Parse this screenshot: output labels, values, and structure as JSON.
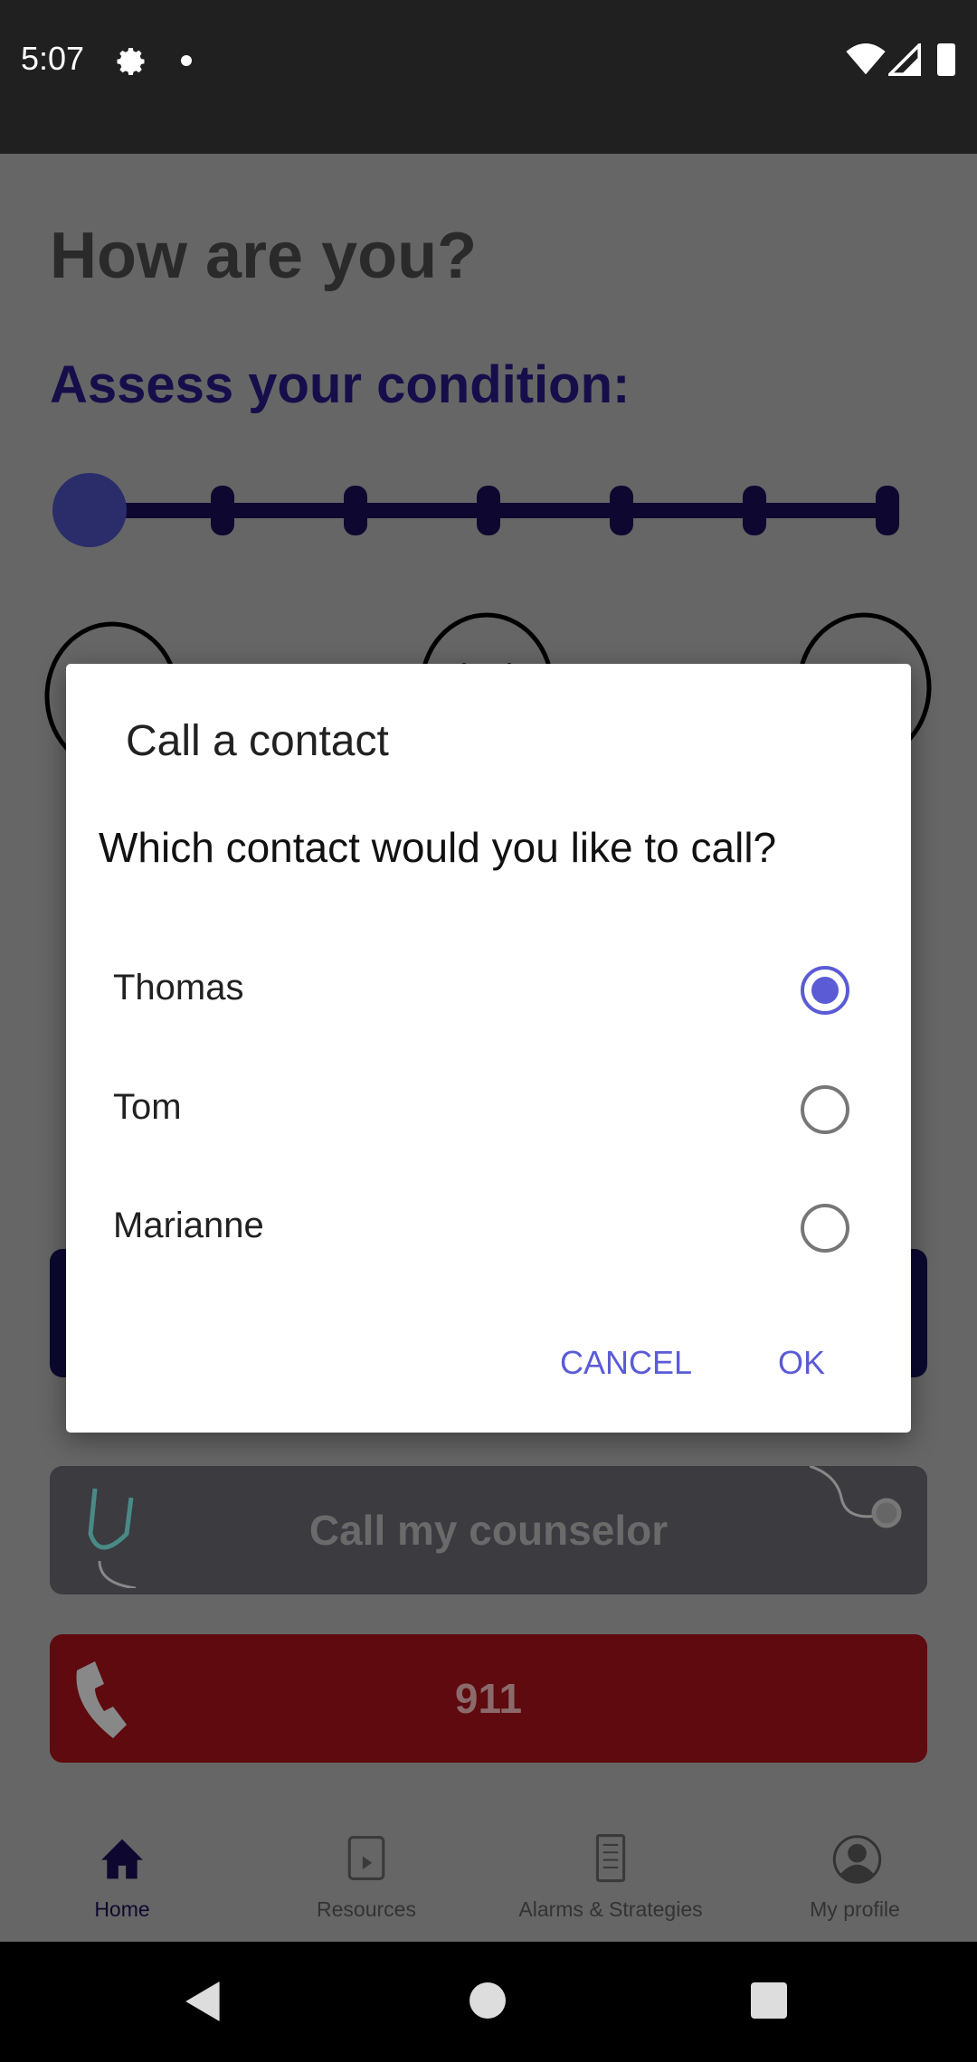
{
  "status_bar": {
    "time": "5:07",
    "icons": [
      "gear-icon",
      "dot-icon",
      "wifi-icon",
      "signal-icon",
      "battery-icon"
    ]
  },
  "page": {
    "title": "How are you?",
    "assess_label": "Assess your condition:",
    "slider": {
      "value": 0,
      "steps": 7
    },
    "cards": {
      "counselor": "Call my counselor",
      "emergency": "911"
    },
    "colors": {
      "accent": "#5b5bd6",
      "emergency": "#5e0a0e",
      "counselor": "#3b3b40",
      "navy": "#160e4a"
    }
  },
  "dialog": {
    "title": "Call a contact",
    "message": "Which contact would you like to call?",
    "options": [
      {
        "label": "Thomas",
        "selected": true
      },
      {
        "label": "Tom",
        "selected": false
      },
      {
        "label": "Marianne",
        "selected": false
      }
    ],
    "cancel": "CANCEL",
    "ok": "OK"
  },
  "bottom_nav": {
    "items": [
      {
        "label": "Home",
        "icon": "home-icon",
        "active": true
      },
      {
        "label": "Resources",
        "icon": "resources-icon"
      },
      {
        "label": "Alarms & Strategies",
        "icon": "document-icon"
      },
      {
        "label": "My profile",
        "icon": "profile-icon"
      }
    ]
  }
}
